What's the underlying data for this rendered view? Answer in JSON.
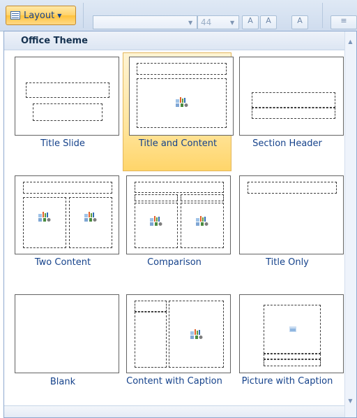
{
  "ribbon": {
    "layout_button_label": "Layout",
    "font_size_value": "44",
    "grow_font_label": "A",
    "shrink_font_label": "A",
    "clear_format_label": "A",
    "list_label": "≡"
  },
  "gallery": {
    "header_title": "Office Theme",
    "layouts": [
      {
        "label": "Title Slide"
      },
      {
        "label": "Title and Content",
        "selected": true
      },
      {
        "label": "Section Header"
      },
      {
        "label": "Two Content"
      },
      {
        "label": "Comparison"
      },
      {
        "label": "Title Only"
      },
      {
        "label": "Blank"
      },
      {
        "label": "Content with Caption"
      },
      {
        "label": "Picture with Caption"
      }
    ]
  },
  "icons": {
    "layout": "layout-icon",
    "dropdown": "chevron-down-icon",
    "content_placeholder": "content-placeholder-icon",
    "picture_placeholder": "picture-placeholder-icon",
    "scroll_up": "chevron-up-icon",
    "scroll_down": "chevron-down-icon"
  },
  "colors": {
    "selected_fill": "#ffd56a",
    "label_text": "#15428b",
    "ribbon_bg": "#dfe9f5"
  }
}
